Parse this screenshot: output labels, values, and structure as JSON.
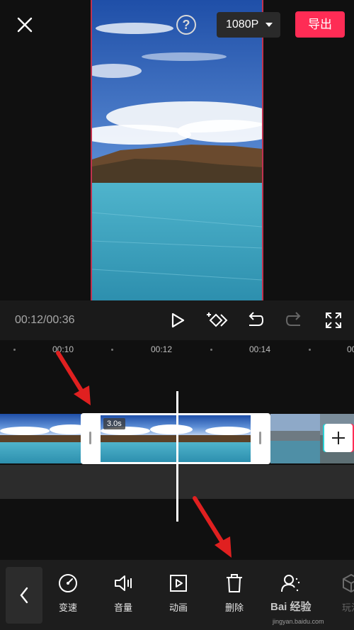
{
  "header": {
    "resolution_label": "1080P",
    "export_label": "导出",
    "help_glyph": "?"
  },
  "playback": {
    "timecode": "00:12/00:36"
  },
  "ruler": {
    "labels": [
      "00:10",
      "00:12",
      "00:14",
      "00"
    ]
  },
  "timeline": {
    "selected_clip_duration": "3.0s"
  },
  "toolbar": {
    "items": [
      {
        "label": "变速",
        "icon": "speed-icon"
      },
      {
        "label": "音量",
        "icon": "volume-icon"
      },
      {
        "label": "动画",
        "icon": "animation-icon"
      },
      {
        "label": "删除",
        "icon": "delete-icon"
      },
      {
        "label": "",
        "icon": "person-effect-icon"
      },
      {
        "label": "玩法",
        "icon": "cube-icon"
      }
    ]
  },
  "watermark": {
    "brand": "Bai 经验",
    "site": "jingyan.baidu.com"
  },
  "colors": {
    "accent": "#fe2c55",
    "background": "#101010",
    "annotation_arrow": "#e02020"
  }
}
